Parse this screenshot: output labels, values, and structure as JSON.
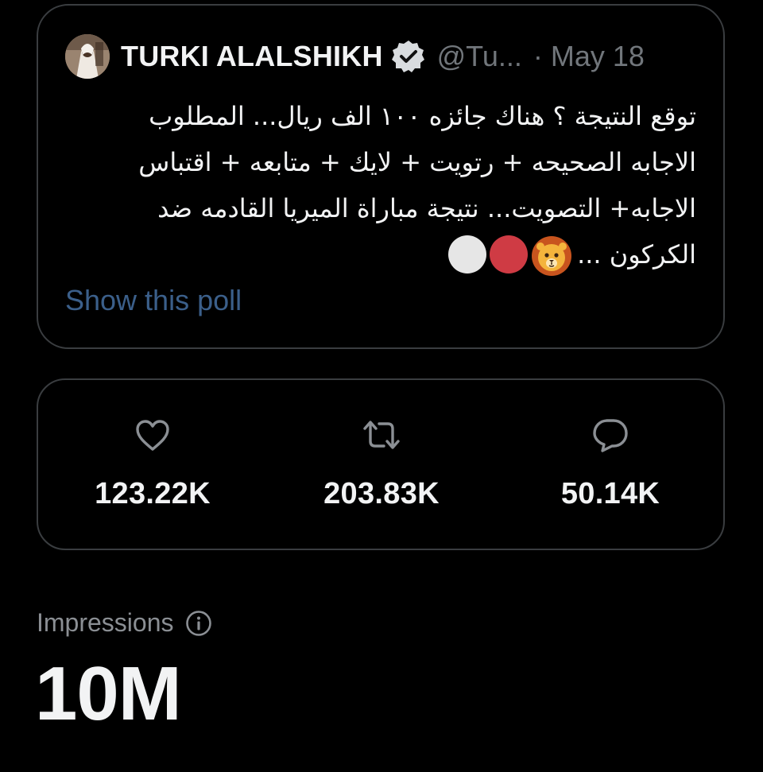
{
  "tweet": {
    "author_name": "TURKI ALALSHIKH",
    "handle": "@Tu...",
    "separator": "·",
    "date": "May 18",
    "text_lines": [
      "توقع النتيجة ؟ هناك جائزه ١٠٠ الف ريال... المطلوب",
      "الاجابه الصحيحه + رتويت + لايك + متابعه + اقتباس",
      "الاجابه+ التصويت... نتيجة مباراة الميريا القادمه ضد",
      "الكركون ..."
    ],
    "emojis": [
      "lion-face",
      "red-circle",
      "white-circle"
    ],
    "poll_link": "Show this poll"
  },
  "stats": {
    "likes": "123.22K",
    "retweets": "203.83K",
    "replies": "50.14K"
  },
  "impressions": {
    "label": "Impressions",
    "value": "10M"
  },
  "colors": {
    "background": "#000000",
    "link": "#3b5f8a",
    "muted": "#71767b",
    "border": "#3a3d40"
  }
}
